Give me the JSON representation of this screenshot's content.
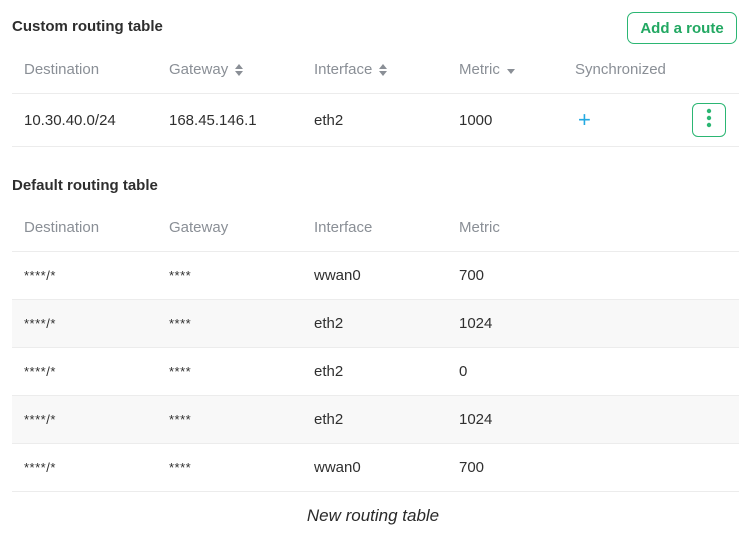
{
  "custom_table": {
    "title": "Custom routing table",
    "add_route_label": "Add a route",
    "columns": [
      "Destination",
      "Gateway",
      "Interface",
      "Metric",
      "Synchronized"
    ],
    "rows": [
      {
        "destination": "10.30.40.0/24",
        "gateway": "168.45.146.1",
        "interface": "eth2",
        "metric": "1000",
        "synchronized": "+"
      }
    ]
  },
  "default_table": {
    "title": "Default routing table",
    "columns": [
      "Destination",
      "Gateway",
      "Interface",
      "Metric"
    ],
    "rows": [
      {
        "destination": "****/*",
        "gateway": "****",
        "interface": "wwan0",
        "metric": "700"
      },
      {
        "destination": "****/*",
        "gateway": "****",
        "interface": "eth2",
        "metric": "1024"
      },
      {
        "destination": "****/*",
        "gateway": "****",
        "interface": "eth2",
        "metric": "0"
      },
      {
        "destination": "****/*",
        "gateway": "****",
        "interface": "eth2",
        "metric": "1024"
      },
      {
        "destination": "****/*",
        "gateway": "****",
        "interface": "wwan0",
        "metric": "700"
      }
    ]
  },
  "caption": "New routing table",
  "colors": {
    "accent_green": "#2bb673",
    "plus_blue": "#23a9e1"
  }
}
